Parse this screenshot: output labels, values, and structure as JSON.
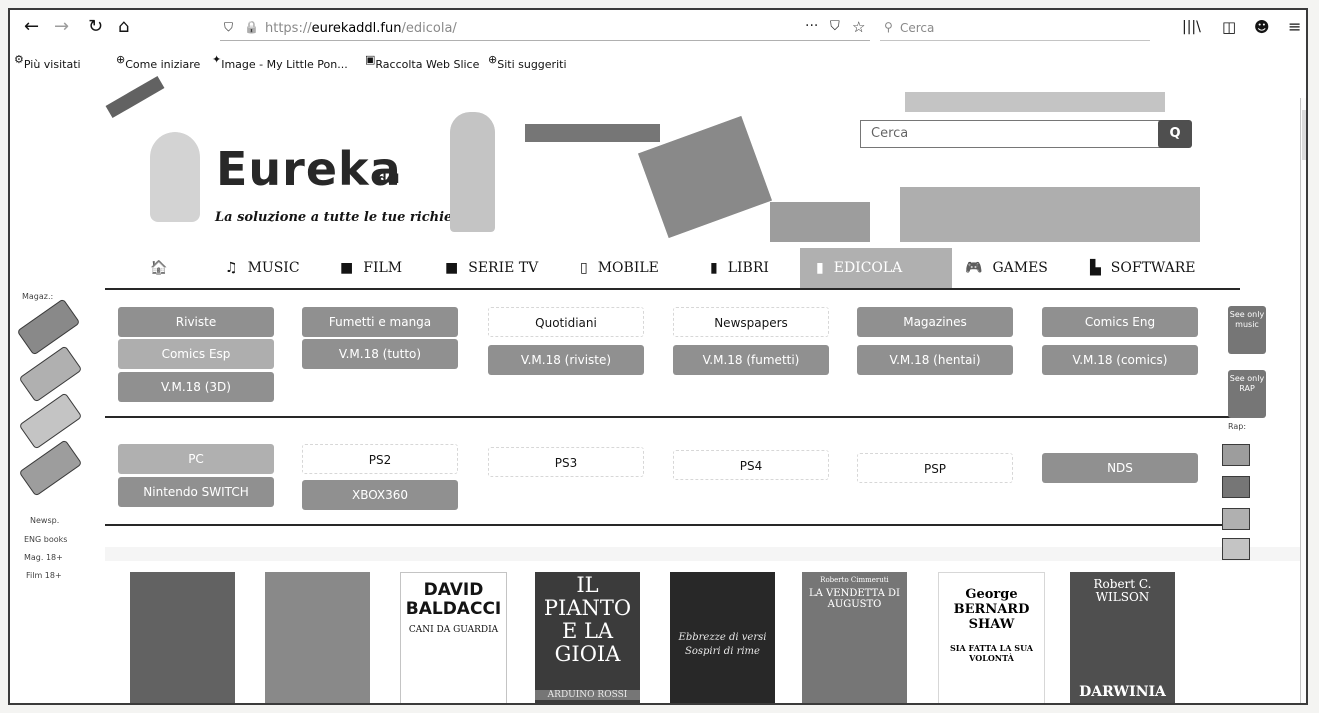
{
  "browser": {
    "url_prefix": "https://",
    "url_domain": "eurekaddl.fun",
    "url_path": "/edicola/",
    "search_placeholder": "Cerca",
    "more": "···",
    "bookmarks": [
      "Più visitati",
      "Come iniziare",
      "Image - My Little Pon...",
      "Raccolta Web Slice",
      "Siti suggeriti"
    ]
  },
  "header": {
    "logo_main": "Eureka",
    "logo_small": "ddl",
    "tagline": "La soluzione a tutte le tue richieste!",
    "search_placeholder": "Cerca",
    "search_button": "Q"
  },
  "menu": {
    "items": [
      {
        "icon": "🏠",
        "label": ""
      },
      {
        "icon": "♫",
        "label": "MUSIC"
      },
      {
        "icon": "■",
        "label": "FILM"
      },
      {
        "icon": "■",
        "label": "SERIE TV"
      },
      {
        "icon": "▯",
        "label": "MOBILE"
      },
      {
        "icon": "▮",
        "label": "LIBRI"
      },
      {
        "icon": "▮",
        "label": "EDICOLA"
      },
      {
        "icon": "🎮",
        "label": "GAMES"
      },
      {
        "icon": "▙",
        "label": "SOFTWARE"
      }
    ]
  },
  "categories": {
    "row1": [
      "Riviste",
      "Fumetti e manga",
      "Quotidiani",
      "Newspapers",
      "Magazines",
      "Comics Eng"
    ],
    "row2": [
      "Comics Esp",
      "V.M.18 (tutto)",
      "V.M.18 (riviste)",
      "V.M.18 (fumetti)",
      "V.M.18 (hentai)",
      "V.M.18 (comics)"
    ],
    "row3": [
      "V.M.18 (3D)"
    ]
  },
  "games": {
    "row1": [
      "PC",
      "PS2",
      "PS3",
      "PS4",
      "PSP",
      "NDS"
    ],
    "row2": [
      "Nintendo SWITCH",
      "XBOX360"
    ]
  },
  "left_sidebar": {
    "top_label": "Magaz.:",
    "links": [
      "Newsp.",
      "ENG books",
      "Mag. 18+",
      "Film 18+"
    ]
  },
  "right_sidebar": {
    "music_button": "See only music",
    "rap_button": "See only RAP",
    "rap_label": "Rap:"
  },
  "books": [
    {
      "title": "",
      "subtitle": ""
    },
    {
      "title": "",
      "subtitle": ""
    },
    {
      "title": "DAVID BALDACCI",
      "subtitle": "CANI DA GUARDIA"
    },
    {
      "title": "IL PIANTO E LA GIOIA",
      "subtitle": "ARDUINO ROSSI"
    },
    {
      "title": "Ebbrezze di versi",
      "subtitle": "Sospiri di rime"
    },
    {
      "title": "LA VENDETTA DI AUGUSTO",
      "subtitle": "Roberto Cimmeruti"
    },
    {
      "title": "George BERNARD SHAW",
      "subtitle": "SIA FATTA LA SUA VOLONTÀ"
    },
    {
      "title": "Robert C. WILSON",
      "subtitle": "DARWINIA"
    }
  ]
}
